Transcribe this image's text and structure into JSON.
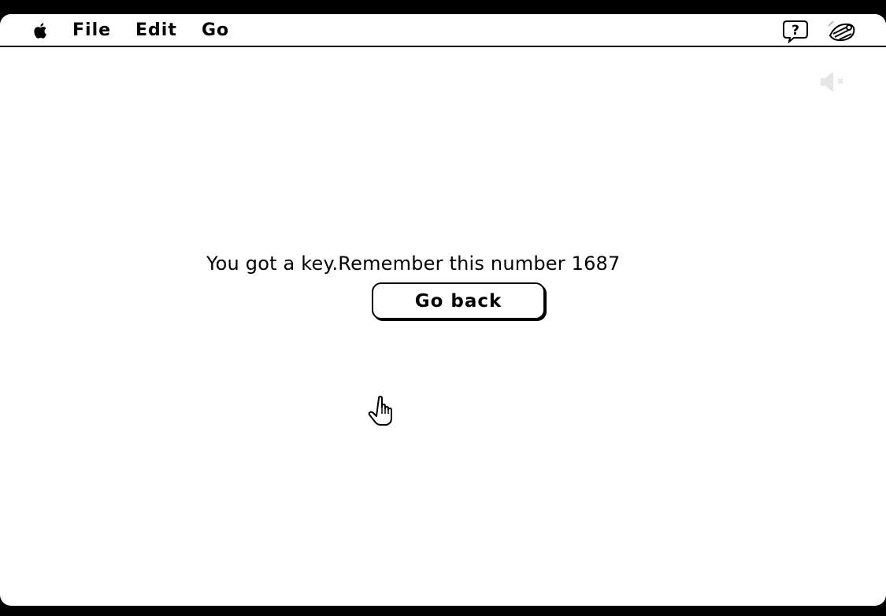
{
  "menubar": {
    "apple_icon": "apple-icon",
    "items": [
      {
        "label": "File"
      },
      {
        "label": "Edit"
      },
      {
        "label": "Go"
      }
    ],
    "help_icon": "help-balloon-icon",
    "app_icon": "app-menu-icon"
  },
  "status": {
    "sound_icon": "speaker-muted-icon"
  },
  "main": {
    "message": "You got a key.Remember this number 1687",
    "button_label": "Go back"
  },
  "cursor": {
    "icon": "hand-pointer-icon"
  }
}
